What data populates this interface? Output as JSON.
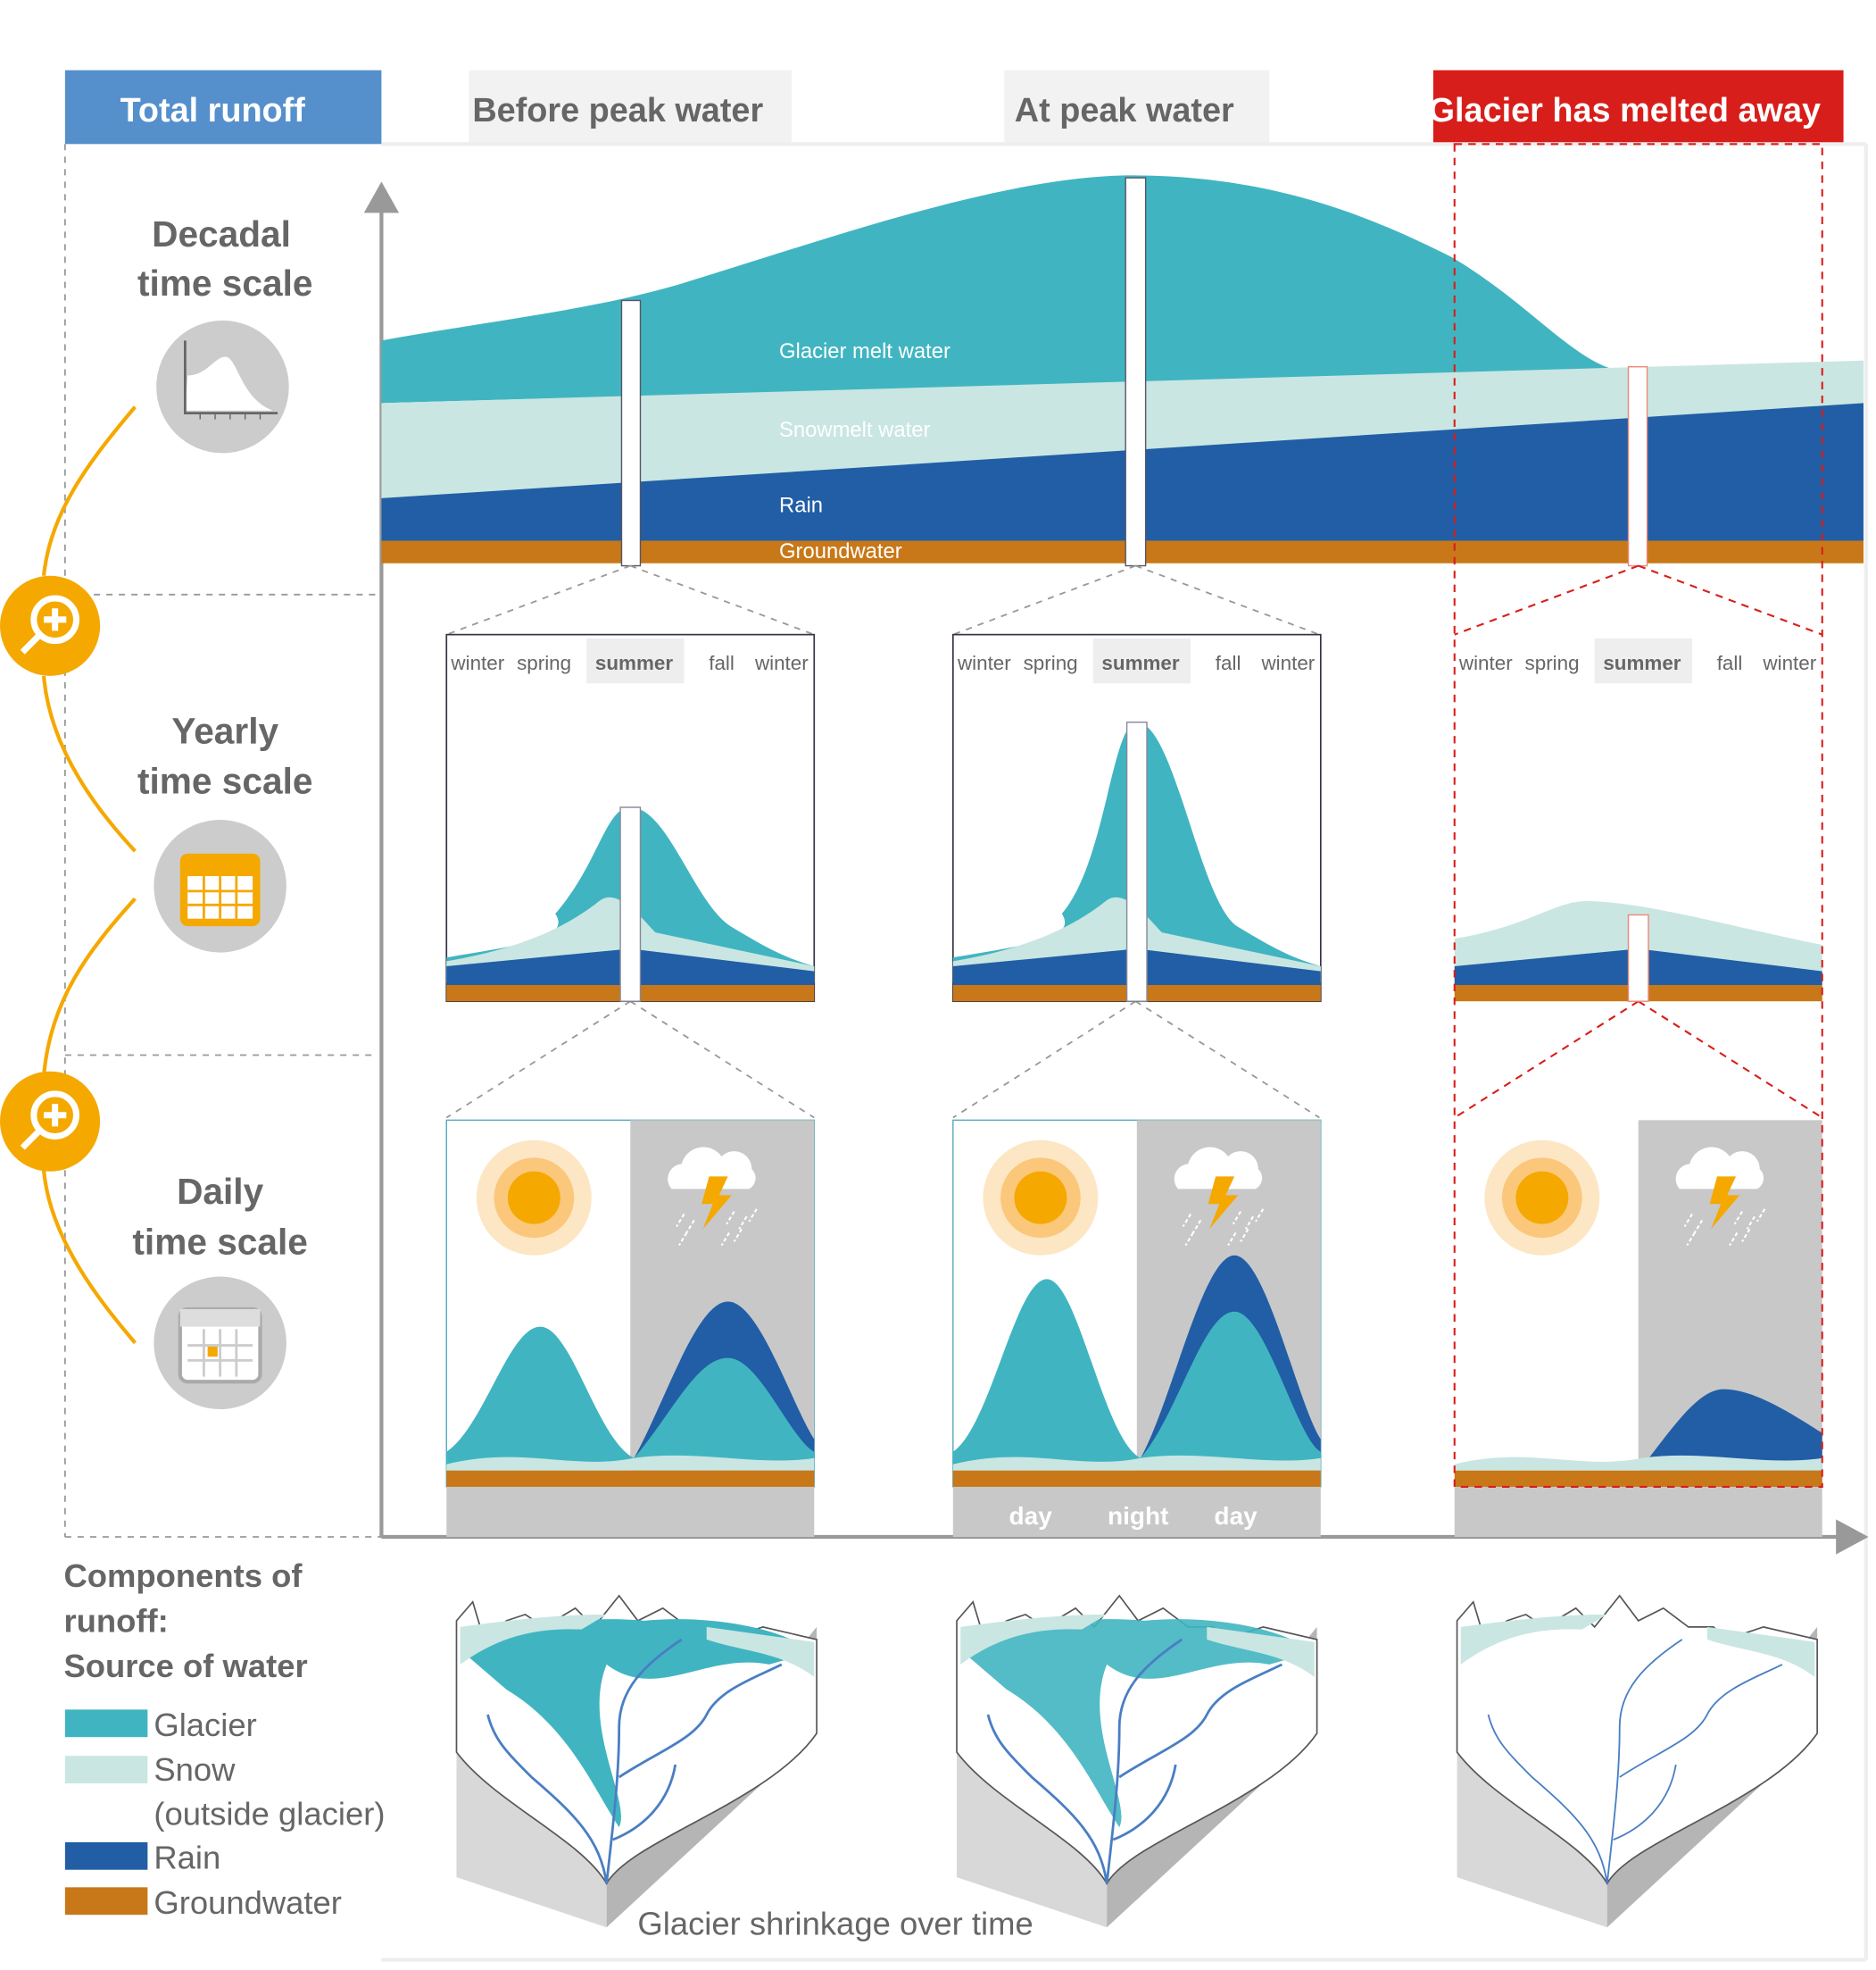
{
  "header": {
    "total_runoff": "Total runoff",
    "stages": [
      "Before peak water",
      "At peak water",
      "Glacier has melted away"
    ]
  },
  "scales": {
    "decadal": [
      "Decadal",
      "time scale"
    ],
    "yearly": [
      "Yearly",
      "time scale"
    ],
    "daily": [
      "Daily",
      "time scale"
    ]
  },
  "layers": {
    "glacier": "Glacier melt water",
    "snow": "Snowmelt water",
    "rain": "Rain",
    "groundwater": "Groundwater"
  },
  "seasons": [
    "winter",
    "spring",
    "summer",
    "fall",
    "winter"
  ],
  "daily_labels": [
    "day",
    "night",
    "day"
  ],
  "legend": {
    "title": [
      "Components of",
      "runoff:",
      "Source of water"
    ],
    "items": [
      {
        "label": "Glacier",
        "color": "#40b5c1"
      },
      {
        "label": "Snow",
        "label2": "(outside glacier)",
        "color": "#c9e6e2"
      },
      {
        "label": "Rain",
        "label2": "",
        "color": "#215ea6"
      },
      {
        "label": "Groundwater",
        "color": "#c87818"
      }
    ]
  },
  "caption": "Glacier shrinkage over time",
  "colors": {
    "header_blue": "#5590cc",
    "header_red": "#d81e1a",
    "stage_bg": "#f2f2f2",
    "accent_orange": "#f5a800"
  },
  "icons": [
    "chart-icon",
    "calendar-icon",
    "calendar-day-icon",
    "zoom-in-icon",
    "sun-icon",
    "storm-cloud-icon"
  ]
}
